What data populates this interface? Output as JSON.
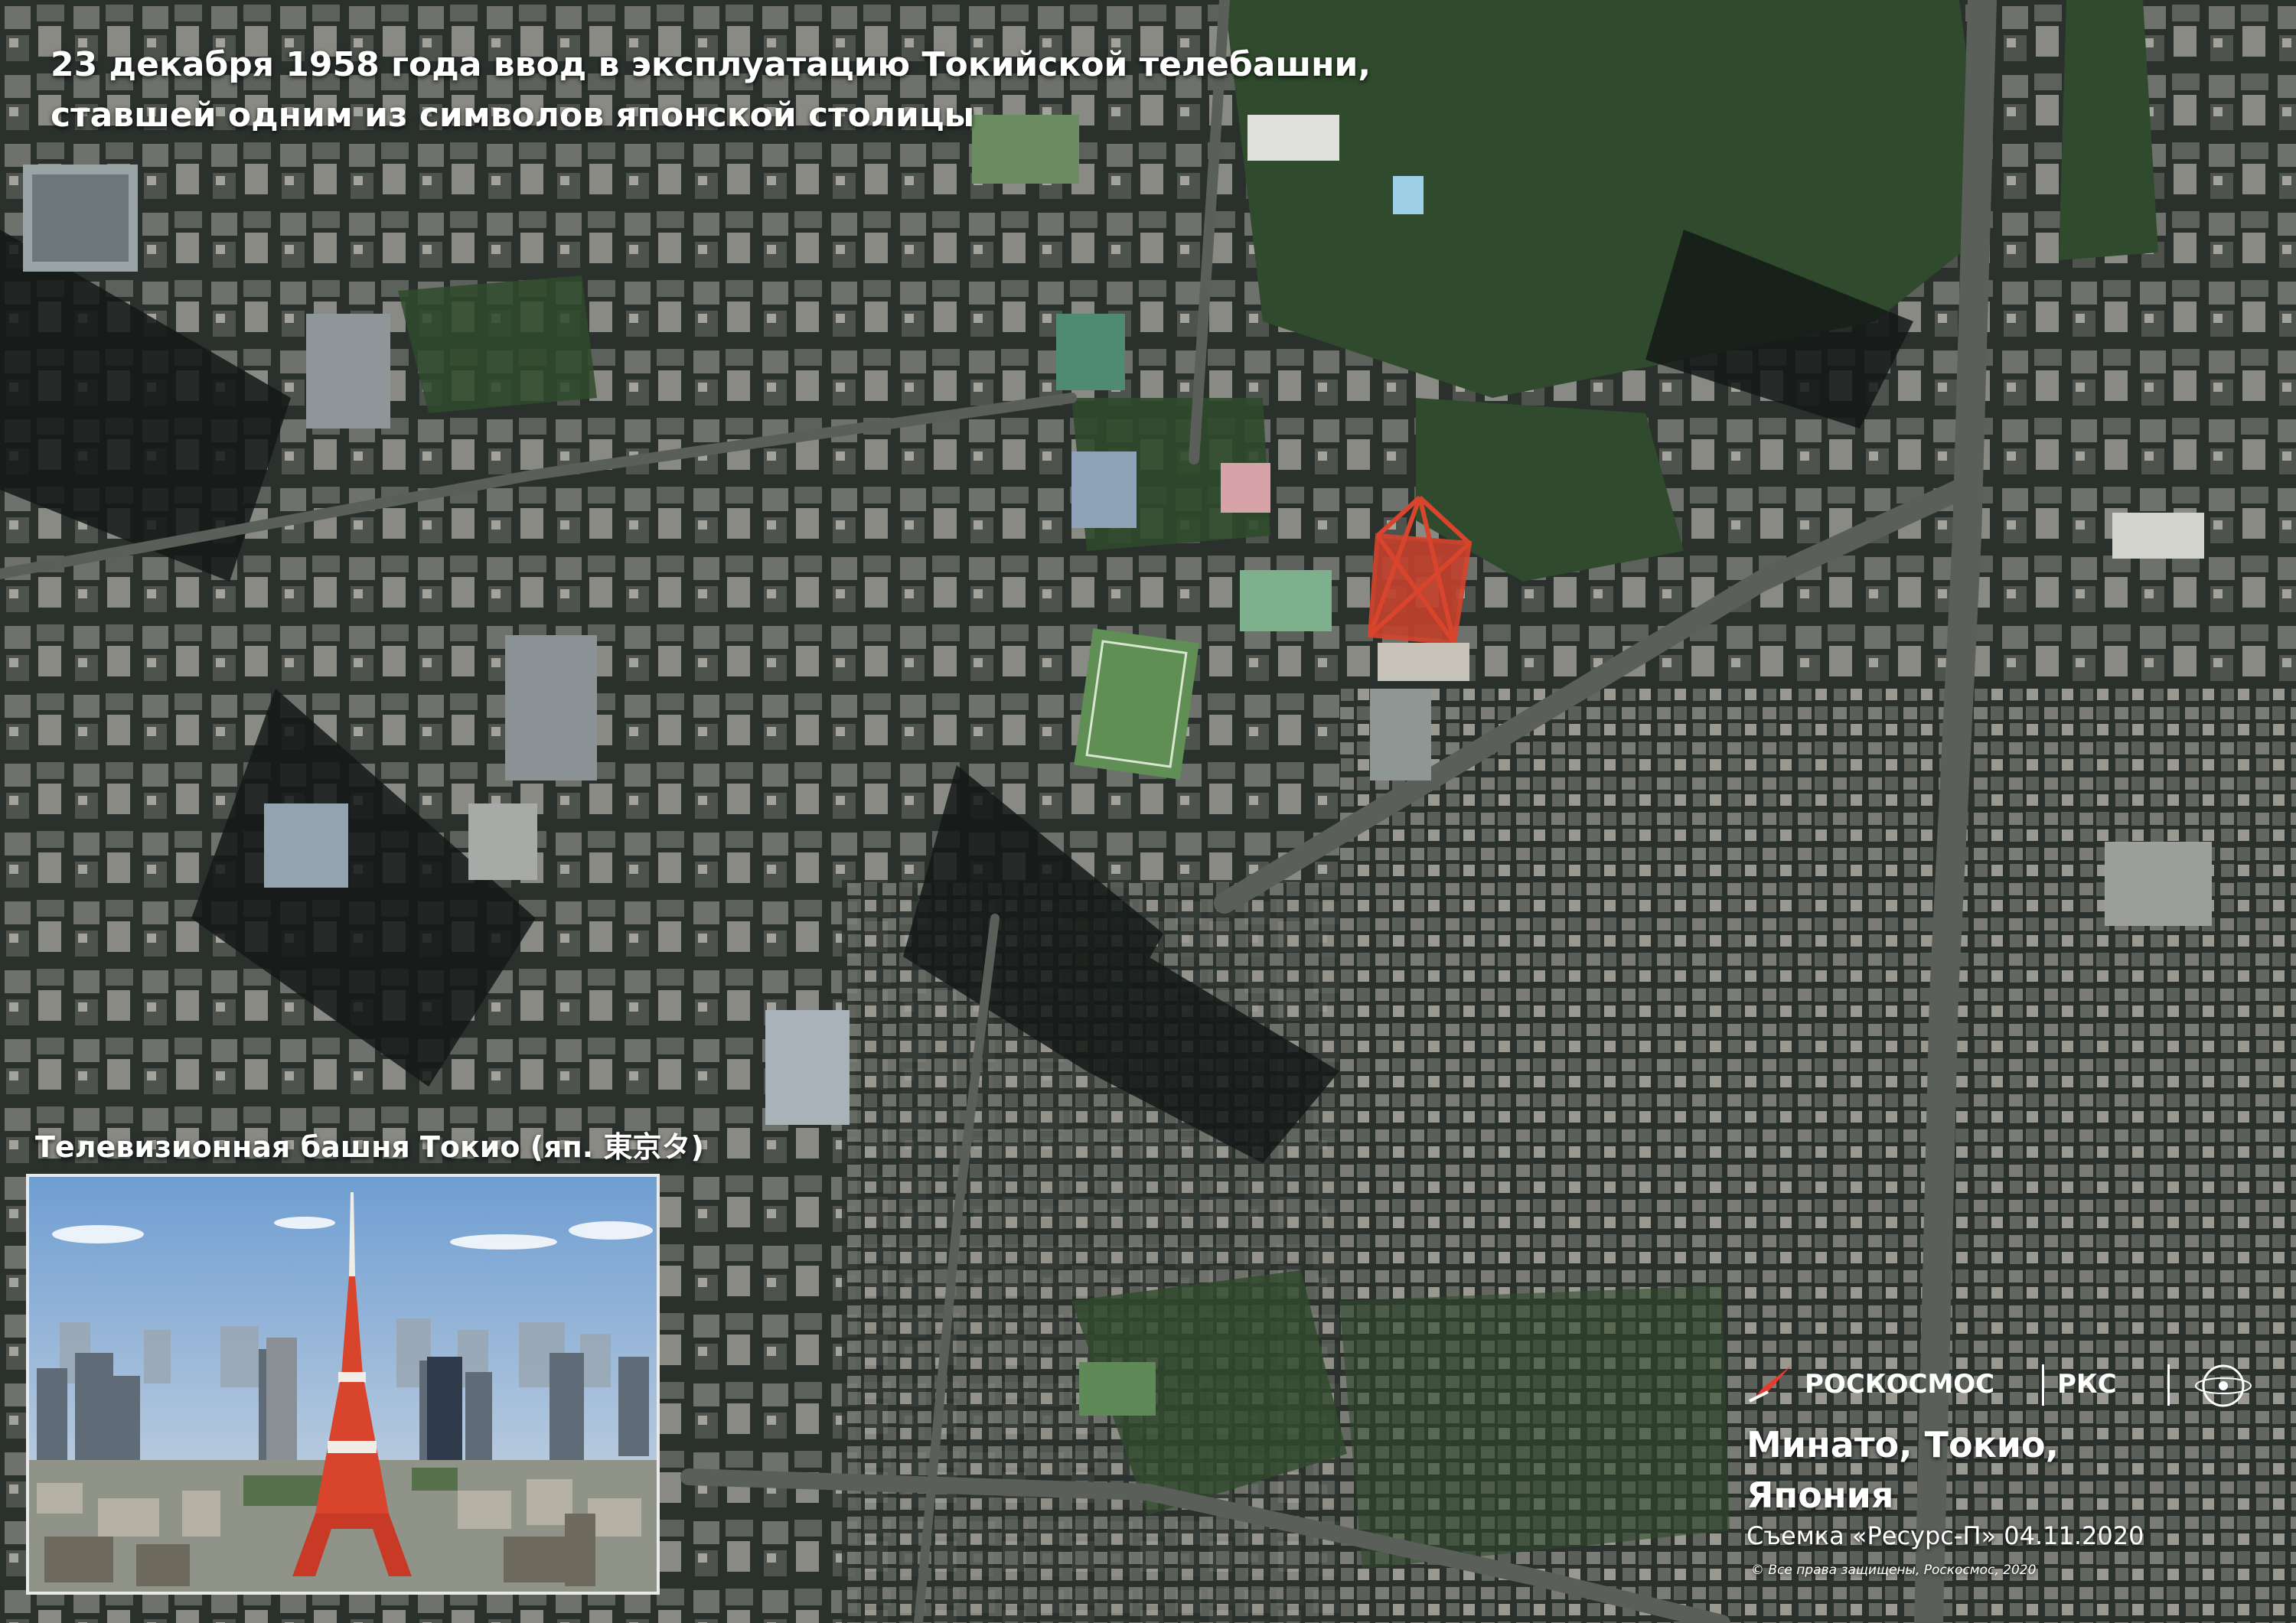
{
  "headline": {
    "line1": "23 декабря 1958 года ввод в эксплуатацию Токийской телебашни,",
    "line2": "ставшей одним из символов японской столицы"
  },
  "inset": {
    "caption": "Телевизионная башня Токио (яп. 東京タ)"
  },
  "branding": {
    "roscosmos": "РОСКОСМОС",
    "rks": "РКС",
    "emblem_icon": "roscosmos-emblem-icon",
    "rocket_icon": "roscosmos-rocket-icon",
    "accent_color": "#e53b2c"
  },
  "location": {
    "line1": "Минато, Токио,",
    "line2": "Япония"
  },
  "capture_info": "Съемка «Ресурс-П» 04.11.2020",
  "copyright": "© Все права защищены, Роскосмос, 2020",
  "colors": {
    "tower_red": "#d8442c",
    "tower_white": "#f0ede6",
    "sky_blue": "#7fa9d4"
  }
}
